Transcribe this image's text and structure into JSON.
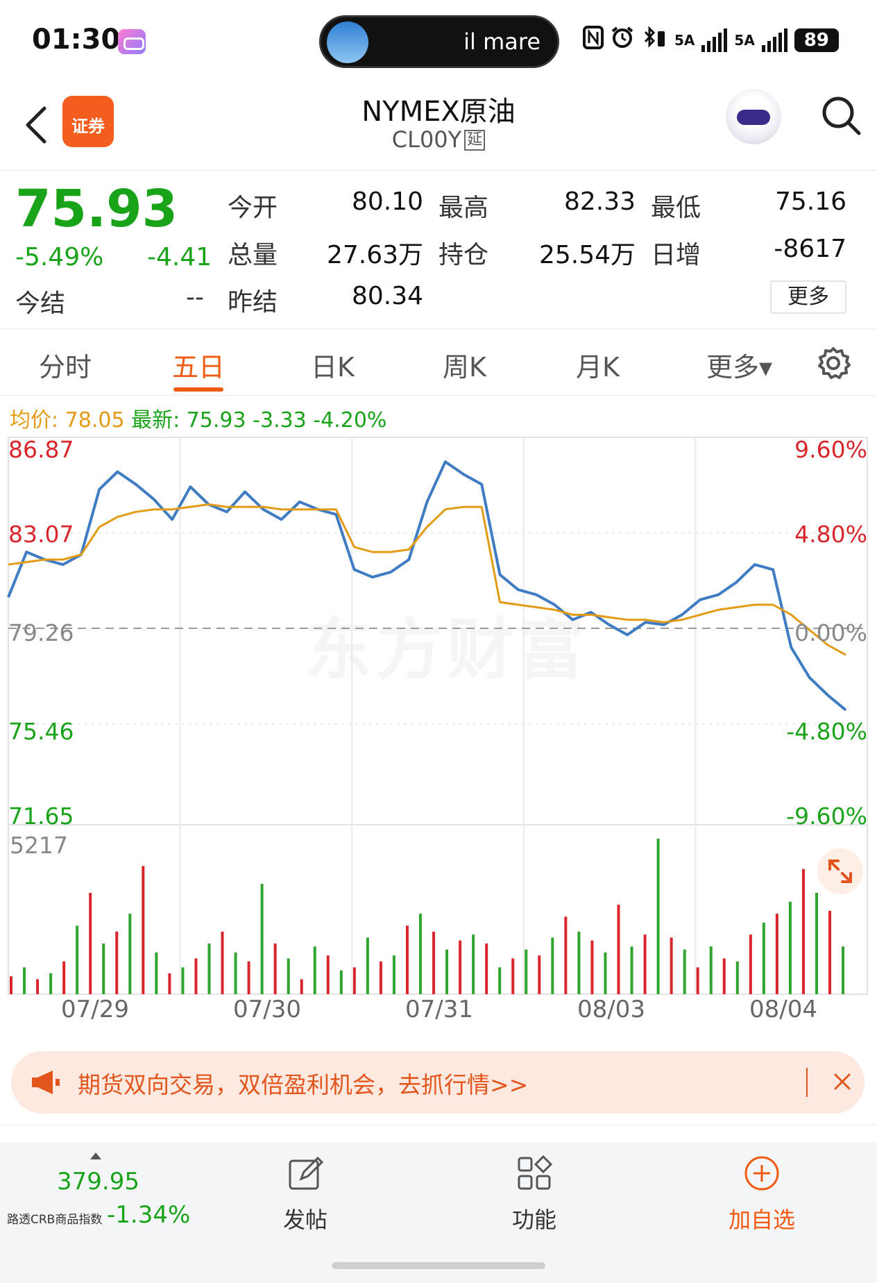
{
  "status_bar": {
    "time": "01:30",
    "now_playing": "il mare",
    "signal1": "5A",
    "signal2": "5A",
    "battery": "89"
  },
  "header": {
    "app_badge": "证券",
    "title": "NYMEX原油",
    "code": "CL00Y",
    "delay_tag": "延"
  },
  "quote": {
    "price": "75.93",
    "change_pct": "-5.49%",
    "change": "-4.41",
    "settle_label": "今结",
    "settle_value": "--",
    "open_label": "今开",
    "open_value": "80.10",
    "high_label": "最高",
    "high_value": "82.33",
    "low_label": "最低",
    "low_value": "75.16",
    "volume_label": "总量",
    "volume_value": "27.63万",
    "oi_label": "持仓",
    "oi_value": "25.54万",
    "daily_inc_label": "日增",
    "daily_inc_value": "-8617",
    "prev_settle_label": "昨结",
    "prev_settle_value": "80.34",
    "more_label": "更多"
  },
  "tabs": [
    "分时",
    "五日",
    "日K",
    "周K",
    "月K",
    "更多▾"
  ],
  "active_tab": "五日",
  "chart_info": {
    "avg_label": "均价: 78.05",
    "latest_label": "最新: 75.93 -3.33 -4.20%"
  },
  "watermark": "东方财富",
  "chart_data": {
    "type": "line",
    "title": "",
    "x": [
      "07/29",
      "07/30",
      "07/31",
      "08/03",
      "08/04"
    ],
    "y_ticks_left": [
      "86.87",
      "83.07",
      "79.26",
      "75.46",
      "71.65"
    ],
    "y_ticks_right": [
      "9.60%",
      "4.80%",
      "0.00%",
      "-4.80%",
      "-9.60%"
    ],
    "ylim": [
      71.65,
      86.87
    ],
    "baseline": 79.26,
    "series": [
      {
        "color": "#3f7cc4",
        "values": [
          80.5,
          82.3,
          82.0,
          81.8,
          82.2,
          84.8,
          85.5,
          85.0,
          84.4,
          83.6,
          84.9,
          84.2,
          83.9,
          84.7,
          84.0,
          83.6,
          84.3,
          84.0,
          83.8,
          81.6,
          81.3,
          81.5,
          82.0,
          84.3,
          85.9,
          85.4,
          85.0,
          81.4,
          80.8,
          80.6,
          80.2,
          79.6,
          79.9,
          79.4,
          79.0,
          79.5,
          79.4,
          79.8,
          80.4,
          80.6,
          81.1,
          81.8,
          81.6,
          78.5,
          77.3,
          76.6,
          76.0
        ]
      },
      {
        "color": "#e39b16",
        "values": [
          81.8,
          81.9,
          82.0,
          82.0,
          82.2,
          83.3,
          83.7,
          83.9,
          84.0,
          84.0,
          84.1,
          84.2,
          84.1,
          84.1,
          84.1,
          84.0,
          84.0,
          84.0,
          84.0,
          82.5,
          82.3,
          82.3,
          82.4,
          83.3,
          84.0,
          84.1,
          84.1,
          80.3,
          80.2,
          80.1,
          80.0,
          79.8,
          79.8,
          79.7,
          79.6,
          79.6,
          79.5,
          79.6,
          79.8,
          80.0,
          80.1,
          80.2,
          80.2,
          79.8,
          79.2,
          78.6,
          78.2
        ]
      }
    ],
    "volume_max": "5217",
    "volume": [
      600,
      900,
      500,
      700,
      1100,
      2300,
      3400,
      1700,
      2100,
      2700,
      4300,
      1400,
      700,
      900,
      1200,
      1700,
      2100,
      1400,
      1100,
      3700,
      1700,
      1200,
      500,
      1600,
      1300,
      800,
      900,
      1900,
      1100,
      1300,
      2300,
      2700,
      2100,
      1500,
      1800,
      2000,
      1700,
      900,
      1200,
      1500,
      1300,
      1900,
      2600,
      2100,
      1800,
      1400,
      3000,
      1600,
      2000,
      5217,
      1900,
      1500,
      900,
      1600,
      1200,
      1100,
      2000,
      2400,
      2700,
      3100,
      4200,
      3400,
      2800,
      1600
    ]
  },
  "banner": {
    "text": "期货双向交易，双倍盈利机会，去抓行情>>"
  },
  "bottom_bar": {
    "index_value": "379.95",
    "index_name": "路透CRB商品指数",
    "index_change": "-1.34%",
    "post_label": "发帖",
    "func_label": "功能",
    "add_label": "加自选"
  }
}
